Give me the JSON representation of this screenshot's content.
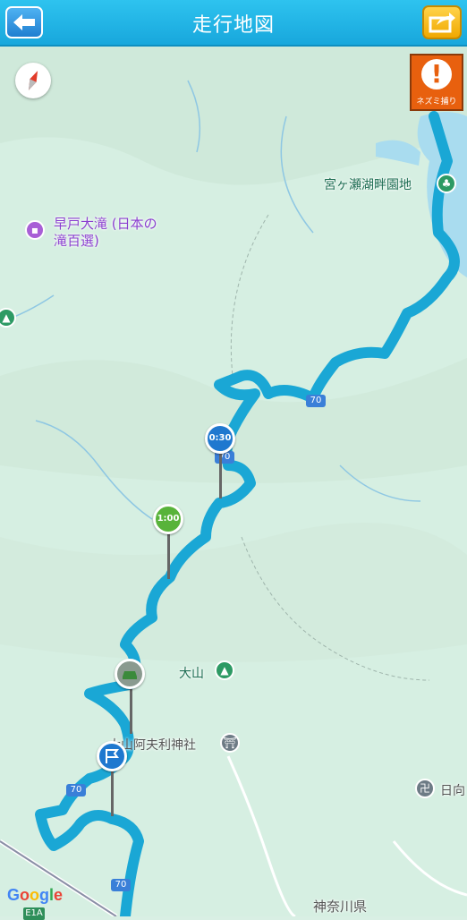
{
  "header": {
    "title": "走行地図"
  },
  "alert": {
    "icon": "!",
    "label": "ネズミ捕り"
  },
  "map": {
    "pois": [
      {
        "label": "宮ヶ瀬湖畔園地"
      },
      {
        "label": "早戸大滝 (日本の滝百選)"
      },
      {
        "label": "大山"
      },
      {
        "label": "大山阿夫利神社"
      },
      {
        "label": "日向"
      },
      {
        "label": "神奈川県"
      }
    ],
    "roads": [
      "70",
      "70",
      "70",
      "70"
    ],
    "highway": "E1A",
    "markers": [
      {
        "text": "0:30"
      },
      {
        "text": "1:00"
      }
    ]
  },
  "footer": {
    "attribution": "Google"
  },
  "colors": {
    "header": "#1aa9dd",
    "route": "#1ba8d6",
    "map": "#d9efe4"
  }
}
